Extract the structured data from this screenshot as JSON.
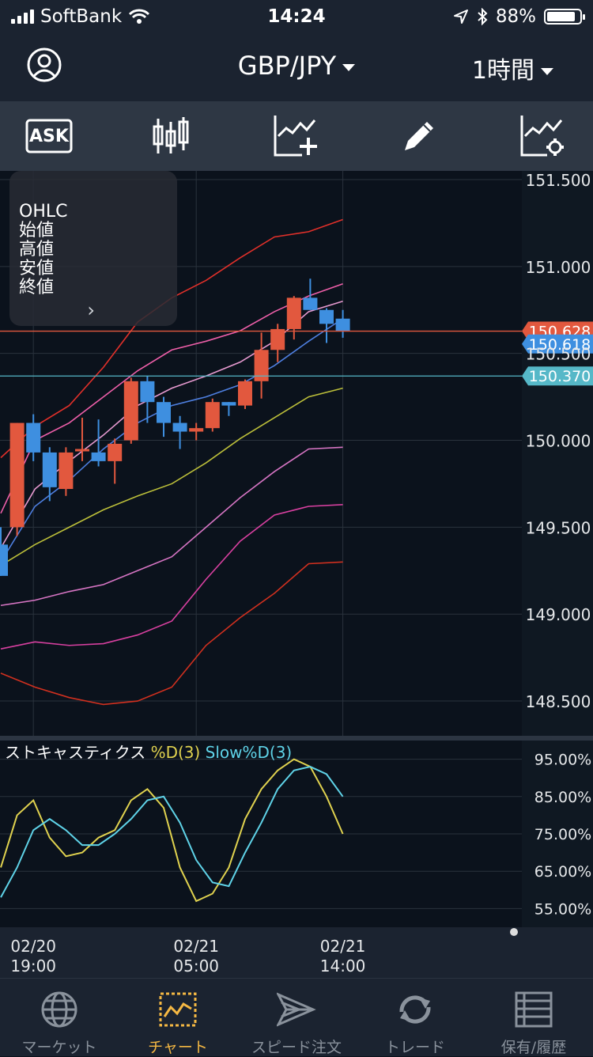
{
  "status_bar": {
    "carrier": "SoftBank",
    "time": "14:24",
    "battery": "88%",
    "battery_level": 0.88
  },
  "header": {
    "pair": "GBP/JPY",
    "timeframe": "1時間"
  },
  "toolbar": {
    "ask_label": "ASK"
  },
  "ohlc_panel": {
    "title": "OHLC",
    "open": "始値",
    "high": "高値",
    "low": "安値",
    "close": "終値"
  },
  "colors": {
    "bull": "#e2583e",
    "bear": "#3e8fe0",
    "stoch_d": "#e0d24f",
    "stoch_slow": "#5fd3e8",
    "accent": "#f5b843"
  },
  "chart_data": [
    {
      "type": "candlestick",
      "y_ticks": [
        "151.500",
        "151.000",
        "150.500",
        "150.000",
        "149.500",
        "149.000",
        "148.500"
      ],
      "ylim": [
        148.3,
        151.55
      ],
      "x_labels": [
        {
          "date": "02/20",
          "time": "19:00"
        },
        {
          "date": "02/21",
          "time": "05:00"
        },
        {
          "date": "02/21",
          "time": "14:00"
        }
      ],
      "price_tags": [
        {
          "label": "150.628",
          "value": 150.628,
          "color": "#e2583e"
        },
        {
          "label": "150.618",
          "value": 150.618,
          "color": "#3e8fe0"
        },
        {
          "label": "150.370",
          "value": 150.37,
          "color": "#56b8c8"
        }
      ],
      "candles": [
        {
          "o": 149.4,
          "h": 149.5,
          "l": 149.22,
          "c": 149.22
        },
        {
          "o": 149.5,
          "h": 150.1,
          "l": 149.45,
          "c": 150.1
        },
        {
          "o": 150.1,
          "h": 150.15,
          "l": 149.88,
          "c": 149.93
        },
        {
          "o": 149.93,
          "h": 149.96,
          "l": 149.65,
          "c": 149.73
        },
        {
          "o": 149.72,
          "h": 149.96,
          "l": 149.68,
          "c": 149.93
        },
        {
          "o": 149.94,
          "h": 150.13,
          "l": 149.88,
          "c": 149.95
        },
        {
          "o": 149.93,
          "h": 150.12,
          "l": 149.85,
          "c": 149.88
        },
        {
          "o": 149.88,
          "h": 150.01,
          "l": 149.75,
          "c": 149.98
        },
        {
          "o": 150.0,
          "h": 150.36,
          "l": 149.98,
          "c": 150.34
        },
        {
          "o": 150.34,
          "h": 150.37,
          "l": 150.1,
          "c": 150.22
        },
        {
          "o": 150.22,
          "h": 150.25,
          "l": 150.02,
          "c": 150.1
        },
        {
          "o": 150.1,
          "h": 150.14,
          "l": 149.95,
          "c": 150.05
        },
        {
          "o": 150.05,
          "h": 150.1,
          "l": 150.0,
          "c": 150.07
        },
        {
          "o": 150.07,
          "h": 150.24,
          "l": 150.05,
          "c": 150.22
        },
        {
          "o": 150.22,
          "h": 150.22,
          "l": 150.14,
          "c": 150.2
        },
        {
          "o": 150.2,
          "h": 150.35,
          "l": 150.18,
          "c": 150.34
        },
        {
          "o": 150.34,
          "h": 150.62,
          "l": 150.24,
          "c": 150.52
        },
        {
          "o": 150.52,
          "h": 150.67,
          "l": 150.45,
          "c": 150.64
        },
        {
          "o": 150.64,
          "h": 150.83,
          "l": 150.58,
          "c": 150.82
        },
        {
          "o": 150.82,
          "h": 150.93,
          "l": 150.75,
          "c": 150.75
        },
        {
          "o": 150.75,
          "h": 150.76,
          "l": 150.56,
          "c": 150.67
        },
        {
          "o": 150.7,
          "h": 150.75,
          "l": 150.59,
          "c": 150.63
        }
      ],
      "bands": [
        {
          "color": "#e1302a",
          "values": [
            149.9,
            150.08,
            150.2,
            150.42,
            150.68,
            150.82,
            150.92,
            151.05,
            151.17,
            151.2,
            151.27
          ]
        },
        {
          "color": "#ee5fa9",
          "values": [
            149.58,
            150.0,
            150.1,
            150.25,
            150.4,
            150.52,
            150.57,
            150.63,
            150.74,
            150.83,
            150.9
          ]
        },
        {
          "color": "#e79ad0",
          "values": [
            149.38,
            149.72,
            149.88,
            150.03,
            150.2,
            150.3,
            150.37,
            150.45,
            150.57,
            150.74,
            150.8
          ]
        },
        {
          "color": "#4e7fe0",
          "values": [
            149.3,
            149.62,
            149.77,
            149.95,
            150.1,
            150.2,
            150.25,
            150.32,
            150.43,
            150.57,
            150.7
          ]
        },
        {
          "color": "#bcbf3a",
          "values": [
            149.28,
            149.4,
            149.5,
            149.6,
            149.68,
            149.75,
            149.87,
            150.01,
            150.13,
            150.25,
            150.3
          ]
        },
        {
          "color": "#d775c4",
          "values": [
            149.05,
            149.08,
            149.13,
            149.17,
            149.25,
            149.33,
            149.5,
            149.67,
            149.82,
            149.95,
            149.96
          ]
        },
        {
          "color": "#d840a0",
          "values": [
            148.8,
            148.84,
            148.82,
            148.83,
            148.88,
            148.96,
            149.2,
            149.42,
            149.57,
            149.62,
            149.63
          ]
        },
        {
          "color": "#d1301f",
          "values": [
            148.66,
            148.58,
            148.52,
            148.48,
            148.5,
            148.58,
            148.82,
            148.98,
            149.12,
            149.29,
            149.3
          ]
        }
      ]
    },
    {
      "type": "line",
      "title": "ストキャスティクス",
      "series": [
        {
          "name": "%D(3)",
          "color": "#e0d24f",
          "values": [
            66,
            80,
            84,
            74,
            69,
            70,
            74,
            76,
            84,
            87,
            82,
            66,
            57,
            59,
            66,
            79,
            87,
            92,
            95,
            93,
            85,
            75
          ]
        },
        {
          "name": "Slow%D(3)",
          "color": "#5fd3e8",
          "values": [
            58,
            66,
            76,
            79,
            76,
            72,
            72,
            75,
            79,
            84,
            85,
            78,
            68,
            62,
            61,
            70,
            78,
            87,
            92,
            93,
            91,
            85
          ]
        }
      ],
      "y_ticks": [
        "95.00%",
        "85.00%",
        "75.00%",
        "65.00%",
        "55.00%"
      ],
      "ylim": [
        50,
        100
      ]
    }
  ],
  "tabs": [
    {
      "label": "マーケット",
      "icon": "globe-icon"
    },
    {
      "label": "チャート",
      "icon": "chart-icon"
    },
    {
      "label": "スピード注文",
      "icon": "speed-order-icon"
    },
    {
      "label": "トレード",
      "icon": "trade-icon"
    },
    {
      "label": "保有/履歴",
      "icon": "list-icon"
    }
  ]
}
